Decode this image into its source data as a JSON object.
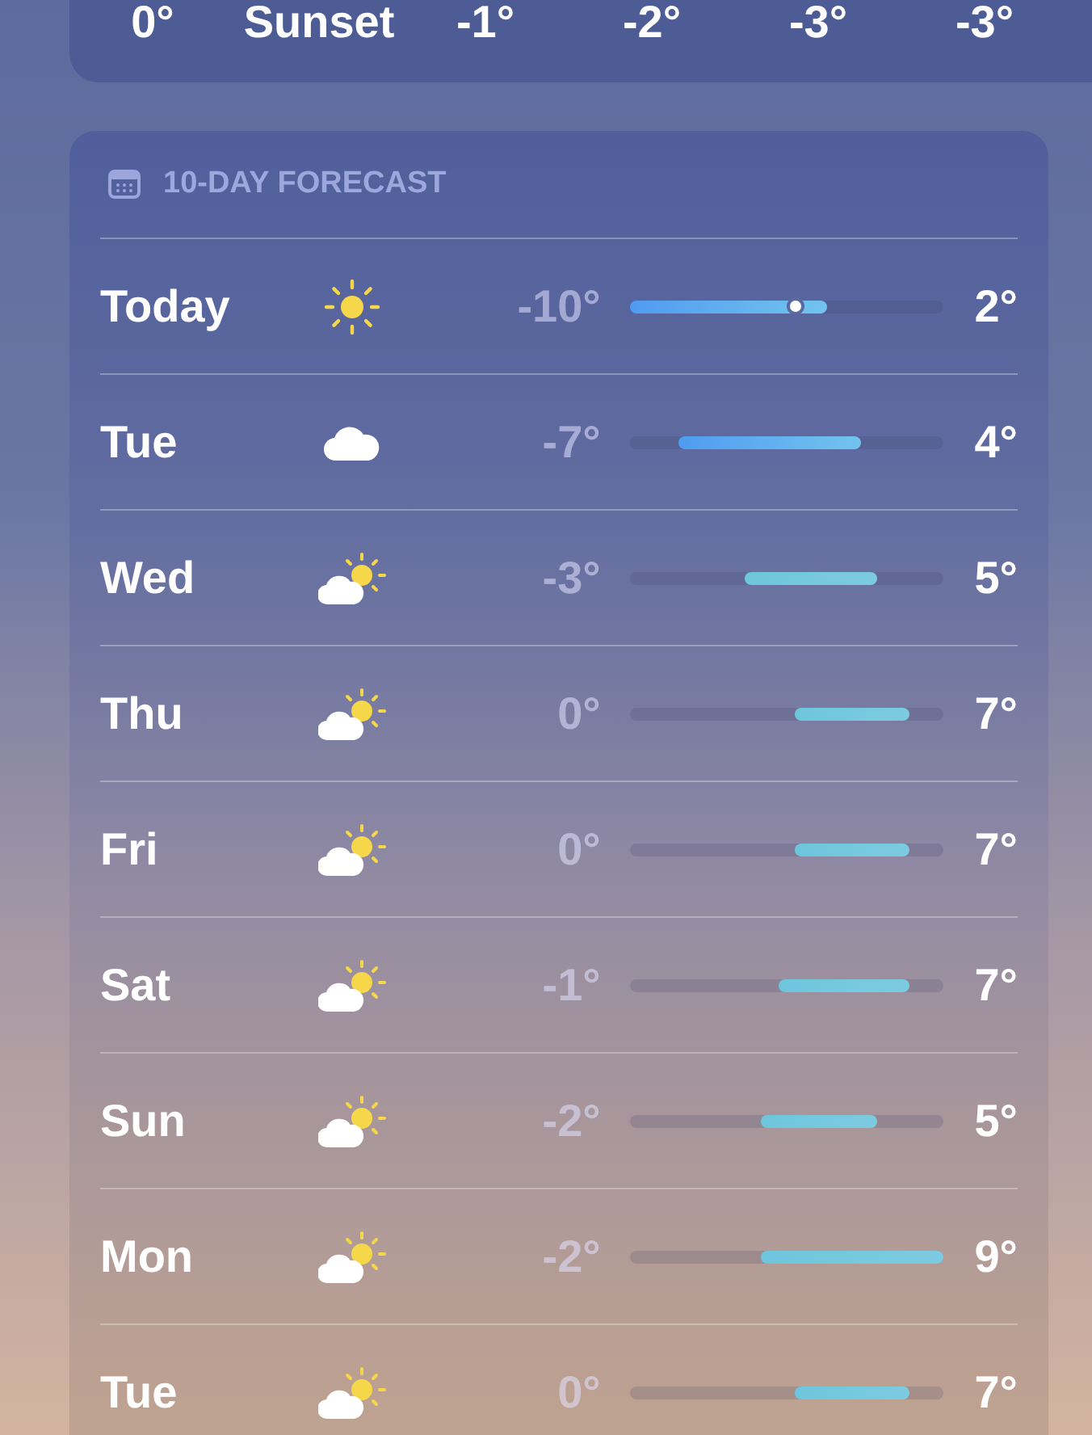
{
  "hourly": [
    {
      "label": "0°"
    },
    {
      "label": "Sunset"
    },
    {
      "label": "-1°"
    },
    {
      "label": "-2°"
    },
    {
      "label": "-3°"
    },
    {
      "label": "-3°"
    }
  ],
  "forecast": {
    "title": "10-DAY FORECAST",
    "days": [
      {
        "day": "Today",
        "kind": "sun",
        "low": "-10°",
        "high": "2°",
        "marker": {
          "level": 0.53
        }
      },
      {
        "day": "Tue",
        "kind": "cloud",
        "low": "-7°",
        "high": "4°"
      },
      {
        "day": "Wed",
        "kind": "partly-sunny",
        "low": "-3°",
        "high": "5°"
      },
      {
        "day": "Thu",
        "kind": "partly-sunny",
        "low": "0°",
        "high": "7°"
      },
      {
        "day": "Fri",
        "kind": "partly-sunny",
        "low": "0°",
        "high": "7°"
      },
      {
        "day": "Sat",
        "kind": "partly-sunny",
        "low": "-1°",
        "high": "7°"
      },
      {
        "day": "Sun",
        "kind": "partly-sunny",
        "low": "-2°",
        "high": "5°"
      },
      {
        "day": "Mon",
        "kind": "partly-sunny",
        "low": "-2°",
        "high": "9°"
      },
      {
        "day": "Tue",
        "kind": "partly-sunny",
        "low": "0°",
        "high": "7°"
      }
    ]
  }
}
